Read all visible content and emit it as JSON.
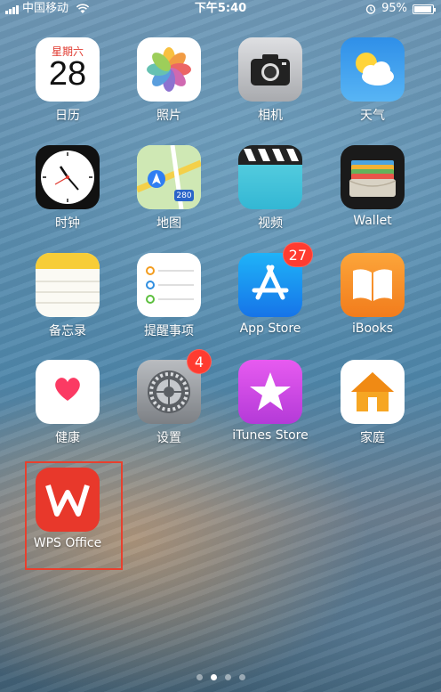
{
  "status_bar": {
    "carrier": "中国移动",
    "time": "下午5:40",
    "battery": "95%",
    "battery_level": 0.95,
    "signal_bars": 4,
    "icons": [
      "signal-icon",
      "wifi-icon",
      "alarm-icon",
      "battery-icon"
    ]
  },
  "apps": [
    {
      "label": "日历",
      "icon": "calendar-icon",
      "weekday": "星期六",
      "day": "28"
    },
    {
      "label": "照片",
      "icon": "photos-icon"
    },
    {
      "label": "相机",
      "icon": "camera-icon"
    },
    {
      "label": "天气",
      "icon": "weather-icon"
    },
    {
      "label": "时钟",
      "icon": "clock-icon"
    },
    {
      "label": "地图",
      "icon": "maps-icon",
      "route": "280"
    },
    {
      "label": "视频",
      "icon": "videos-icon"
    },
    {
      "label": "Wallet",
      "icon": "wallet-icon"
    },
    {
      "label": "备忘录",
      "icon": "notes-icon"
    },
    {
      "label": "提醒事项",
      "icon": "reminders-icon"
    },
    {
      "label": "App Store",
      "icon": "app-store-icon",
      "badge": "27"
    },
    {
      "label": "iBooks",
      "icon": "ibooks-icon"
    },
    {
      "label": "健康",
      "icon": "health-icon"
    },
    {
      "label": "设置",
      "icon": "settings-icon",
      "badge": "4"
    },
    {
      "label": "iTunes Store",
      "icon": "itunes-store-icon"
    },
    {
      "label": "家庭",
      "icon": "home-icon"
    },
    {
      "label": "WPS Office",
      "icon": "wps-office-icon"
    }
  ],
  "page_indicator": {
    "pages": 4,
    "current": 2
  },
  "colors": {
    "highlight": "#e8402e",
    "badge": "#ff3b30",
    "wps": "#e8382b"
  }
}
